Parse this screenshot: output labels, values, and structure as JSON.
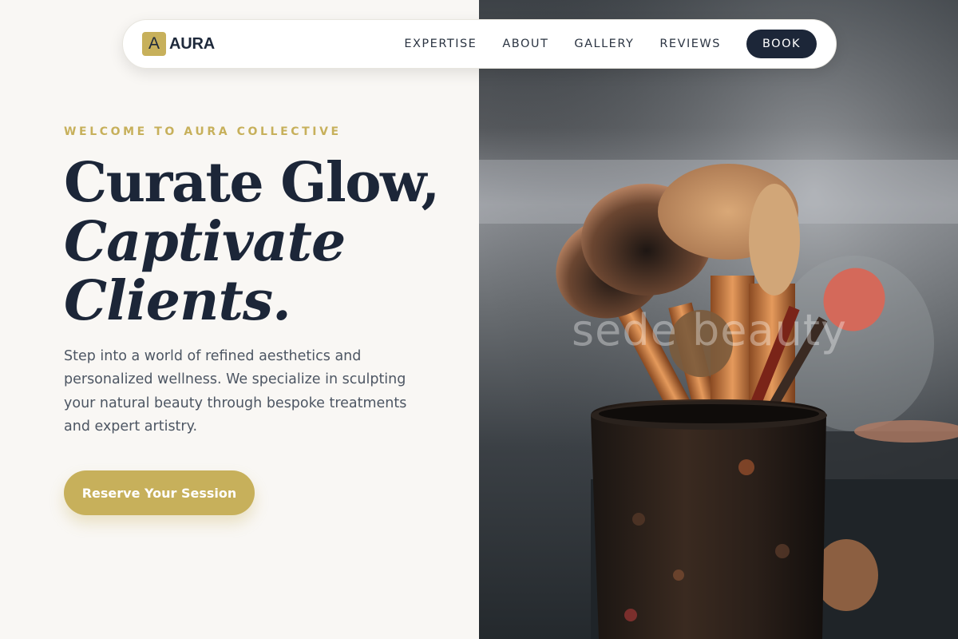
{
  "nav": {
    "logo_mark": "A",
    "logo_text": "AURA",
    "links": [
      "EXPERTISE",
      "ABOUT",
      "GALLERY",
      "REVIEWS"
    ],
    "book_label": "BOOK"
  },
  "hero": {
    "eyebrow": "WELCOME TO AURA COLLECTIVE",
    "headline_line1": "Curate Glow,",
    "headline_line2": "Captivate",
    "headline_line3": "Clients.",
    "lead": "Step into a world of refined aesthetics and personalized wellness. We specialize in sculpting your natural beauty through bespoke treatments and expert artistry.",
    "cta_label": "Reserve Your Session"
  },
  "photo": {
    "watermark": "sede beauty"
  },
  "colors": {
    "accent_gold": "#c7b05b",
    "navy": "#1c2638",
    "page_bg": "#f9f7f4",
    "body_text": "#4d5663"
  }
}
